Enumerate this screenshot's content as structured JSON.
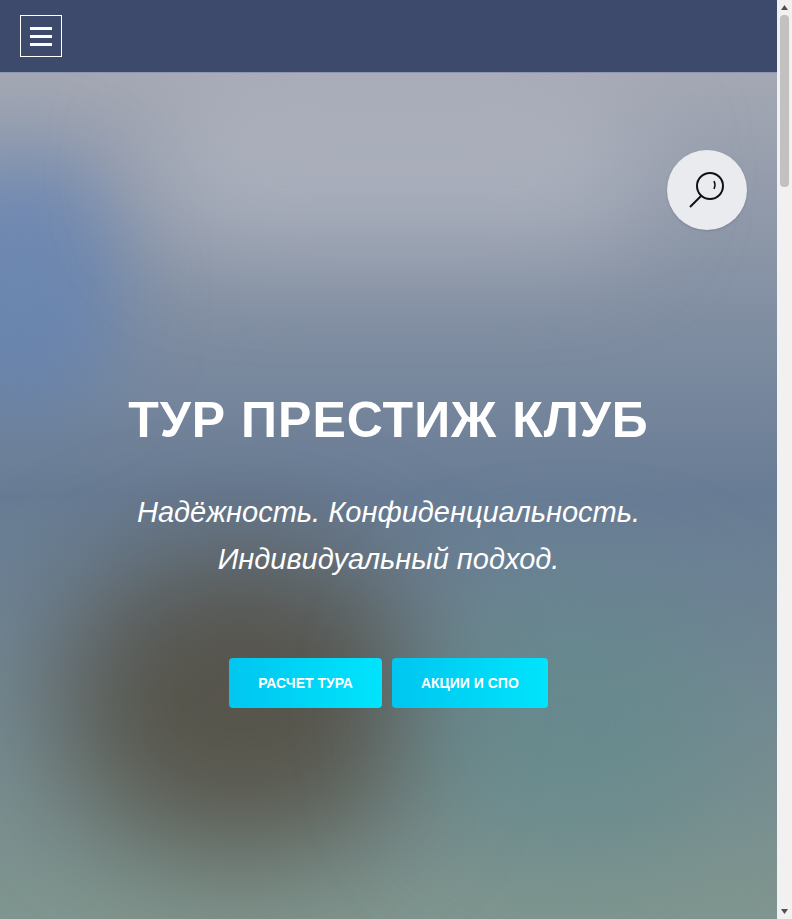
{
  "hero": {
    "title": "ТУР ПРЕСТИЖ КЛУБ",
    "subtitle_lines": [
      "Надёжность. Конфиденциальность.",
      "Индивидуальный подход."
    ],
    "buttons": [
      "РАСЧЕТ ТУРА",
      "АКЦИИ И СПО"
    ]
  }
}
